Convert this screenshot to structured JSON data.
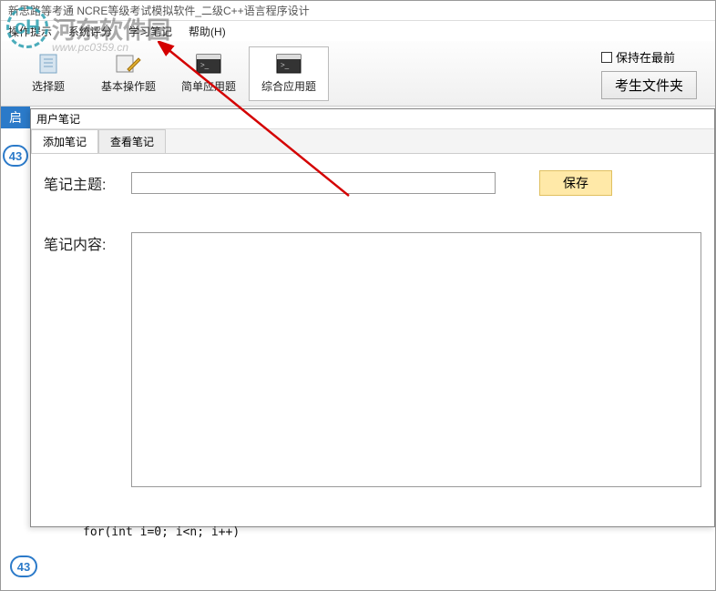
{
  "window_title": "新思路等考通 NCRE等级考试模拟软件_二级C++语言程序设计",
  "menu": {
    "operation_tips": "操作提示",
    "system_score": "系统评分",
    "study_notes": "学习笔记",
    "help": "帮助(H)"
  },
  "toolbar": {
    "choice": "选择题",
    "basic_op": "基本操作题",
    "simple_app": "简单应用题",
    "complex_app": "综合应用题"
  },
  "right": {
    "keep_front": "保持在最前",
    "student_folder": "考生文件夹"
  },
  "left": {
    "qi": "启",
    "q43": "43"
  },
  "notes": {
    "window_title": "用户笔记",
    "tab_add": "添加笔记",
    "tab_view": "查看笔记",
    "subject_label": "笔记主题:",
    "content_label": "笔记内容:",
    "save": "保存",
    "subject_value": "",
    "content_value": ""
  },
  "bottom": {
    "q43": "43"
  },
  "code_snippet": "for(int i=0; i<n; i++)",
  "watermark": {
    "logo": "cH",
    "text": "河东软件园",
    "url": "www.pc0359.cn"
  }
}
